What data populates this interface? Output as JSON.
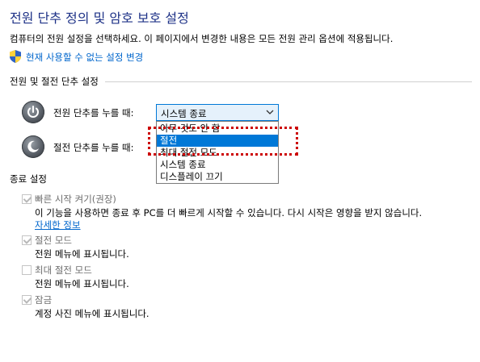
{
  "page": {
    "title": "전원 단추 정의 및 암호 보호 설정",
    "description": "컴퓨터의 전원 설정을 선택하세요. 이 페이지에서 변경한 내용은 모든 전원 관리 옵션에 적용됩니다.",
    "change_link": "현재 사용할 수 없는 설정 변경"
  },
  "power_section": {
    "header": "전원 및 절전 단추 설정",
    "power_button": {
      "label": "전원 단추를 누를 때:",
      "selected": "시스템 종료"
    },
    "sleep_button": {
      "label": "절전 단추를 누를 때:"
    },
    "dropdown_options": [
      "아무 것도 안 함",
      "절전",
      "최대 절전 모드",
      "시스템 종료",
      "디스플레이 끄기"
    ],
    "highlighted_option": "절전"
  },
  "shutdown_section": {
    "header": "종료 설정",
    "fast_startup": {
      "label": "빠른 시작 켜기(권장)",
      "desc": "이 기능을 사용하면 종료 후 PC를 더 빠르게 시작할 수 있습니다. 다시 시작은 영향을 받지 않습니다.",
      "more_link": "자세한 정보",
      "checked": true
    },
    "sleep": {
      "label": "절전 모드",
      "desc": "전원 메뉴에 표시됩니다.",
      "checked": true
    },
    "hibernate": {
      "label": "최대 절전 모드",
      "desc": "전원 메뉴에 표시됩니다.",
      "checked": false
    },
    "lock": {
      "label": "잠금",
      "desc": "계정 사진 메뉴에 표시됩니다.",
      "checked": true
    }
  },
  "colors": {
    "title": "#1e3287",
    "link": "#0066cc",
    "selection": "#0078d7",
    "annotation": "#cc0000"
  }
}
